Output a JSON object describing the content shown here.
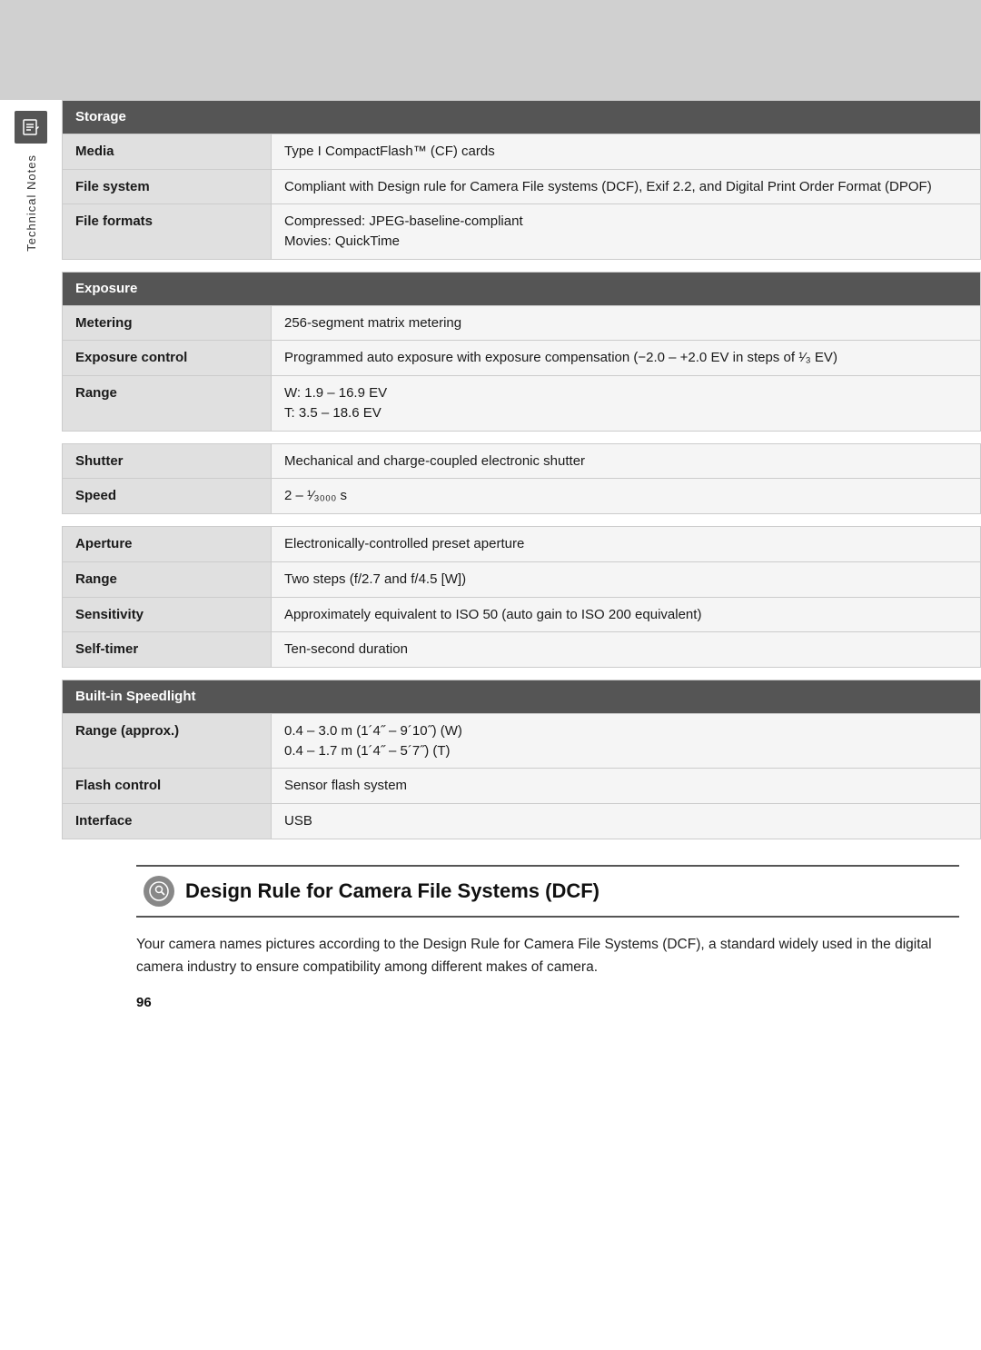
{
  "top_banner": {},
  "sidebar": {
    "icon_label": "📋",
    "text": "Technical Notes"
  },
  "table": {
    "sections": [
      {
        "type": "header",
        "label": "Storage"
      },
      {
        "type": "row",
        "label": "Media",
        "value": "Type I CompactFlash™ (CF) cards"
      },
      {
        "type": "row",
        "label": "File system",
        "value": "Compliant with Design rule for Camera File systems (DCF), Exif 2.2, and Digital Print Order Format (DPOF)"
      },
      {
        "type": "row",
        "label": "File formats",
        "value": "Compressed: JPEG-baseline-compliant\nMovies: QuickTime"
      },
      {
        "type": "divider"
      },
      {
        "type": "header",
        "label": "Exposure"
      },
      {
        "type": "row",
        "label": "Metering",
        "value": "256-segment matrix metering"
      },
      {
        "type": "row",
        "label": "Exposure control",
        "value": "Programmed auto exposure with exposure compensation (−2.0 – +2.0 EV in steps of ¹⁄₃ EV)"
      },
      {
        "type": "row",
        "label": "Range",
        "value": "W: 1.9 – 16.9 EV\nT: 3.5 – 18.6 EV"
      },
      {
        "type": "divider"
      },
      {
        "type": "row",
        "label": "Shutter",
        "value": "Mechanical and charge-coupled electronic shutter"
      },
      {
        "type": "row",
        "label": "Speed",
        "value": "2 – ¹⁄₃₀₀₀ s"
      },
      {
        "type": "divider"
      },
      {
        "type": "row",
        "label": "Aperture",
        "value": "Electronically-controlled preset aperture"
      },
      {
        "type": "row",
        "label": "Range",
        "value": "Two steps (f/2.7 and f/4.5 [W])"
      },
      {
        "type": "row",
        "label": "Sensitivity",
        "value": "Approximately equivalent to ISO 50 (auto gain to ISO 200 equivalent)"
      },
      {
        "type": "row",
        "label": "Self-timer",
        "value": "Ten-second duration"
      },
      {
        "type": "divider"
      },
      {
        "type": "header",
        "label": "Built-in Speedlight"
      },
      {
        "type": "row",
        "label": "Range (approx.)",
        "value": "0.4 – 3.0 m (1´4˝ – 9´10˝) (W)\n0.4 – 1.7 m (1´4˝ – 5´7˝) (T)"
      },
      {
        "type": "row",
        "label": "Flash control",
        "value": "Sensor flash system"
      },
      {
        "type": "row",
        "label": "Interface",
        "value": "USB"
      }
    ]
  },
  "dcf_section": {
    "icon": "🔍",
    "title": "Design Rule for Camera File Systems (DCF)",
    "body": "Your camera names pictures according to the Design Rule for Camera File Systems (DCF), a standard widely used in the digital camera industry to ensure compatibility among different makes of camera.",
    "page_number": "96"
  }
}
